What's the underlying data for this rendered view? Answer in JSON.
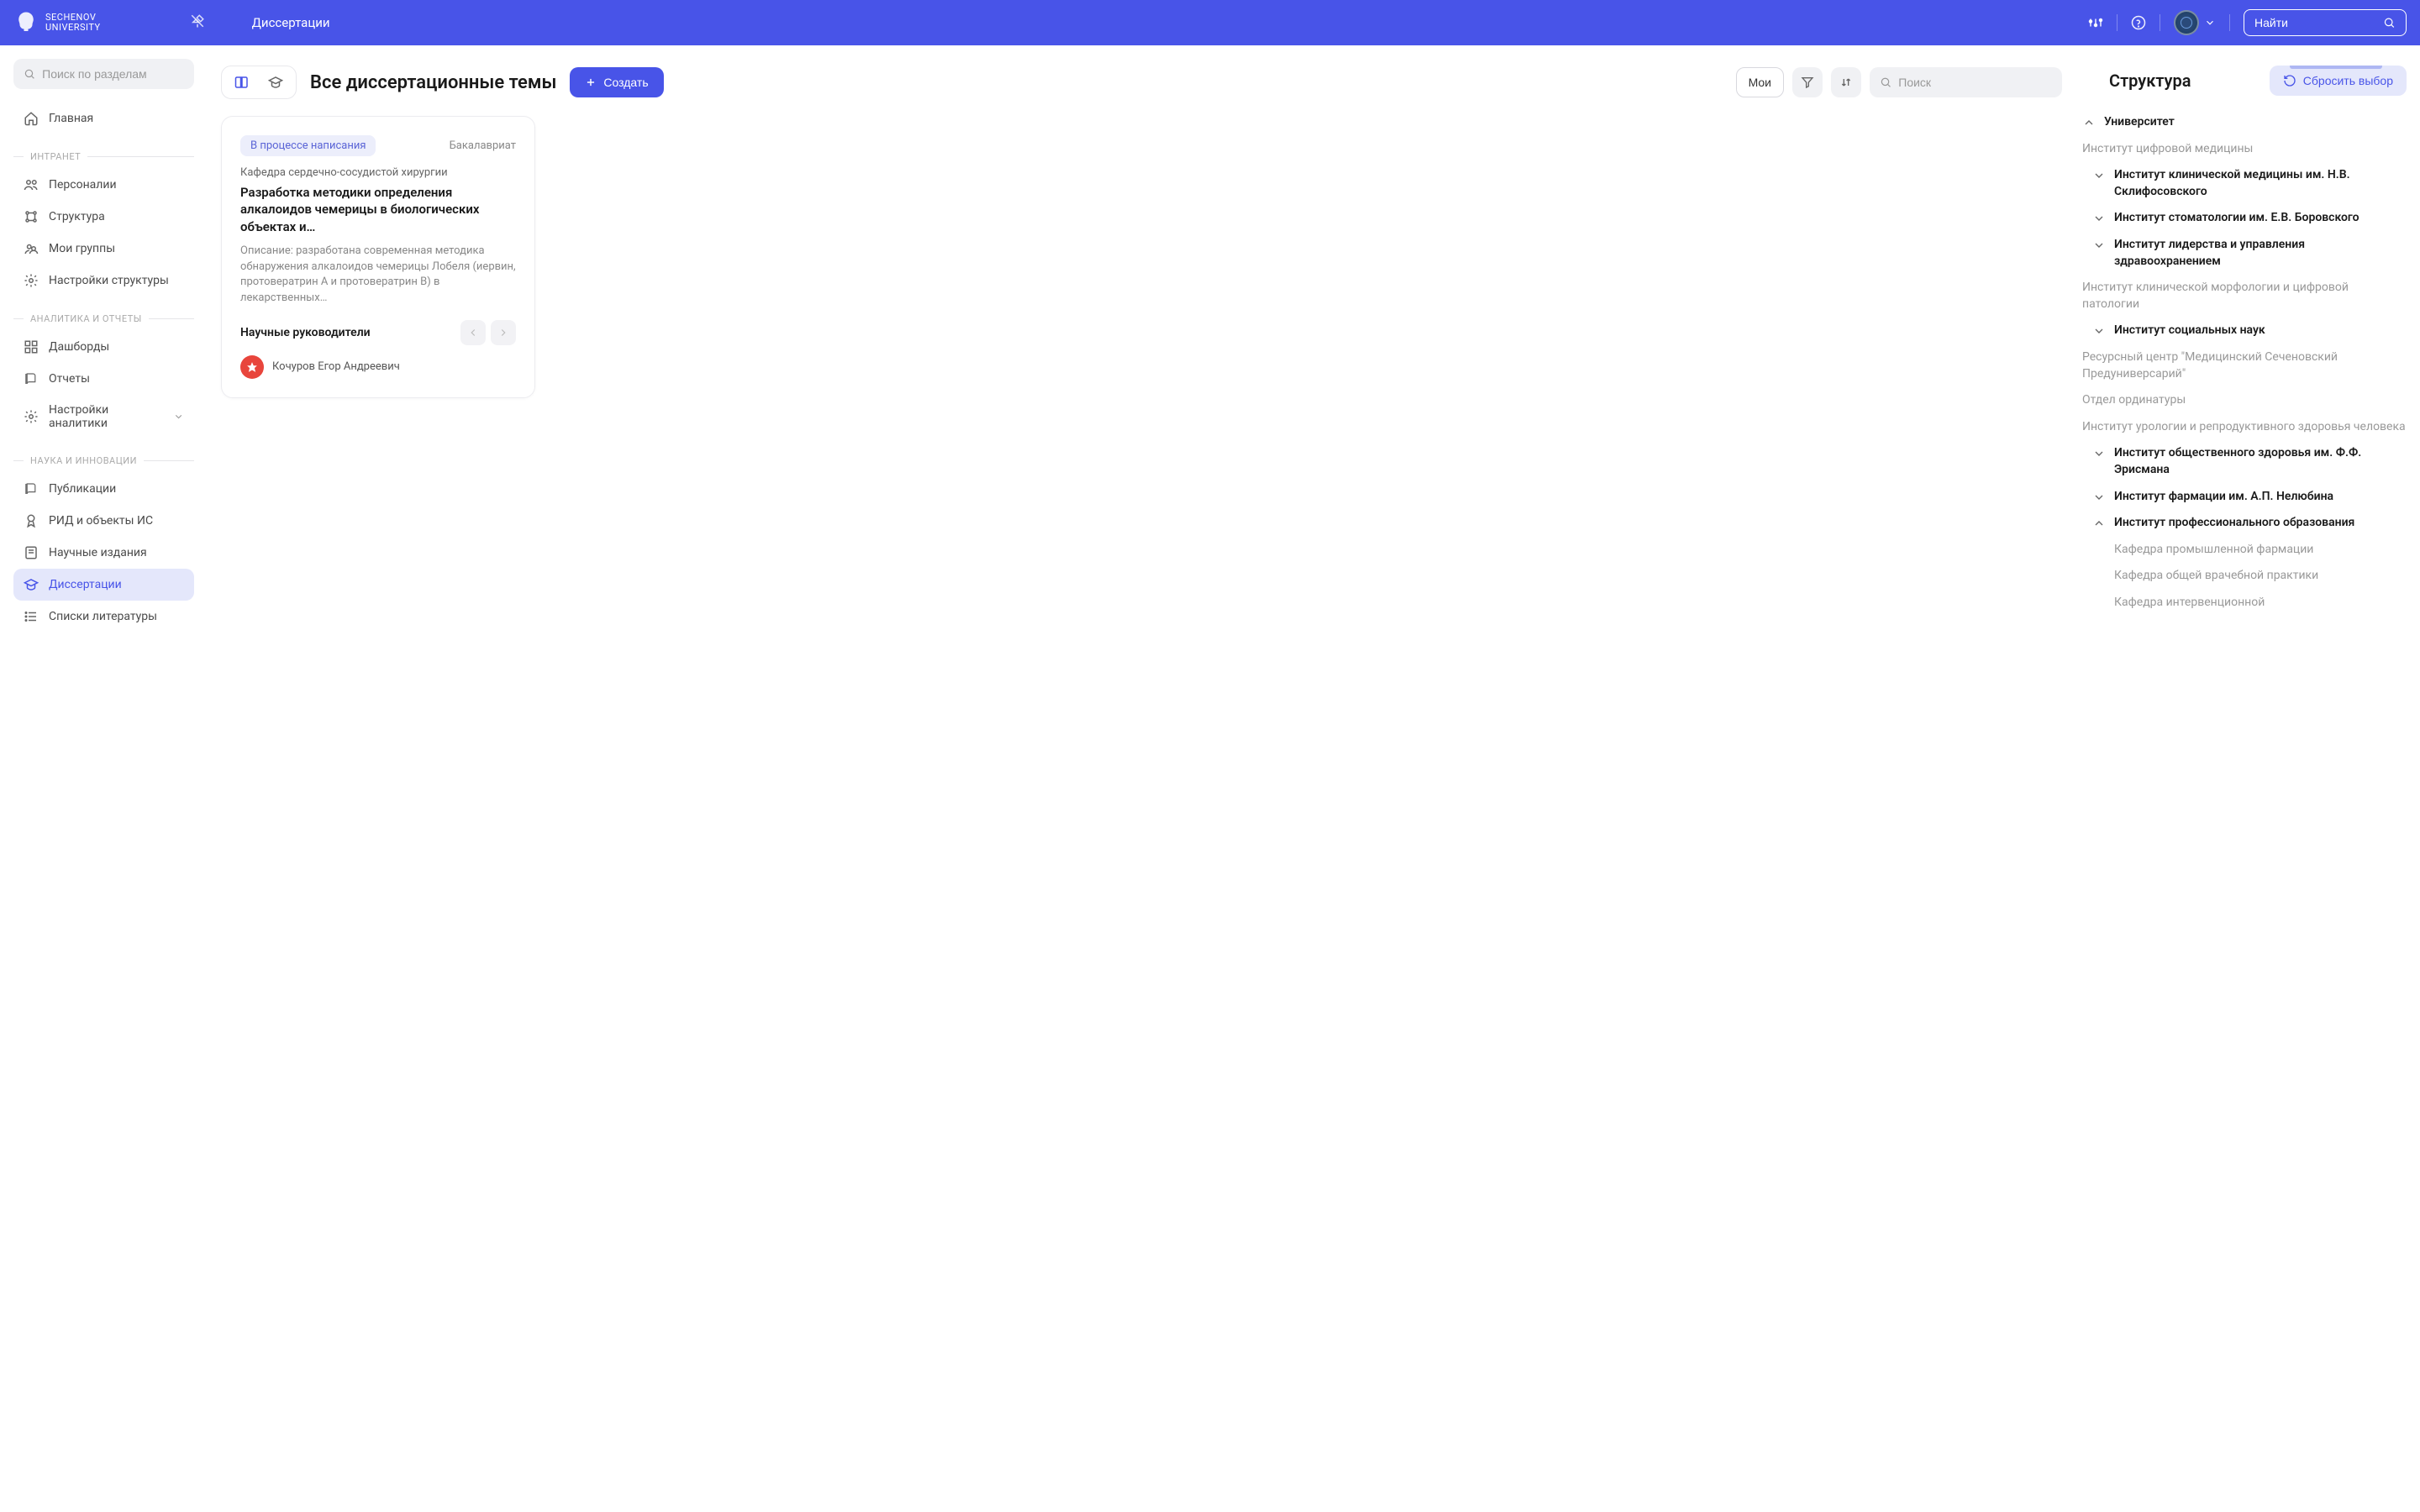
{
  "header": {
    "brand_line1": "SECHENOV",
    "brand_line2": "UNIVERSITY",
    "title": "Диссертации",
    "search_placeholder": "Найти"
  },
  "sidebar": {
    "search_placeholder": "Поиск по разделам",
    "items": [
      {
        "label": "Главная",
        "icon": "home"
      }
    ],
    "sections": [
      {
        "label": "ИНТРАНЕТ",
        "items": [
          {
            "label": "Персоналии",
            "icon": "users"
          },
          {
            "label": "Структура",
            "icon": "structure"
          },
          {
            "label": "Мои группы",
            "icon": "groups"
          },
          {
            "label": "Настройки структуры",
            "icon": "gear"
          }
        ]
      },
      {
        "label": "АНАЛИТИКА И ОТЧЕТЫ",
        "items": [
          {
            "label": "Дашборды",
            "icon": "dashboard"
          },
          {
            "label": "Отчеты",
            "icon": "book"
          },
          {
            "label": "Настройки аналитики",
            "icon": "gear",
            "expandable": true
          }
        ]
      },
      {
        "label": "НАУКА И ИННОВАЦИИ",
        "items": [
          {
            "label": "Публикации",
            "icon": "book"
          },
          {
            "label": "РИД и объекты ИС",
            "icon": "award"
          },
          {
            "label": "Научные издания",
            "icon": "journal"
          },
          {
            "label": "Диссертации",
            "icon": "graduation",
            "active": true
          },
          {
            "label": "Списки литературы",
            "icon": "list"
          }
        ]
      }
    ]
  },
  "content": {
    "title": "Все диссертационные темы",
    "create_label": "Создать",
    "mine_label": "Мои",
    "search_placeholder": "Поиск"
  },
  "card": {
    "status": "В процессе написания",
    "degree": "Бакалавриат",
    "department": "Кафедра сердечно-сосудистой хирургии",
    "title": "Разработка методики определения алкалоидов чемерицы в биологических объектах и…",
    "description": "Описание: разработана современная методика обнаружения алкалоидов чемерицы Лобеля (иервин, протовератрин А и протовератрин В) в лекарственных…",
    "supervisors_label": "Научные руководители",
    "supervisor_name": "Кочуров Егор Андреевич"
  },
  "structure": {
    "title": "Структура",
    "reset_label": "Сбросить выбор",
    "root": "Университет",
    "tree": [
      {
        "label": "Институт цифровой медицины",
        "muted": true,
        "leaf": true
      },
      {
        "label": "Институт клинической медицины им. Н.В. Склифосовского",
        "bold": true,
        "chevron": "down"
      },
      {
        "label": "Институт стоматологии им. Е.В. Боровского",
        "bold": true,
        "chevron": "down"
      },
      {
        "label": "Институт лидерства и управления здравоохранением",
        "bold": true,
        "chevron": "down"
      },
      {
        "label": "Институт клинической морфологии и цифровой патологии",
        "muted": true,
        "leaf": true
      },
      {
        "label": "Институт социальных наук",
        "bold": true,
        "chevron": "down"
      },
      {
        "label": "Ресурсный центр \"Медицинский Сеченовский Предуниверсарий\"",
        "muted": true,
        "leaf": true
      },
      {
        "label": "Отдел ординатуры",
        "muted": true,
        "leaf": true
      },
      {
        "label": "Институт урологии и репродуктивного здоровья человека",
        "muted": true,
        "leaf": true
      },
      {
        "label": "Институт общественного здоровья им. Ф.Ф. Эрисмана",
        "bold": true,
        "chevron": "down"
      },
      {
        "label": "Институт фармации им. А.П. Нелюбина",
        "bold": true,
        "chevron": "down"
      },
      {
        "label": "Институт профессионального образования",
        "bold": true,
        "chevron": "up",
        "expanded": true,
        "children": [
          {
            "label": "Кафедра промышленной фармации",
            "muted": true
          },
          {
            "label": "Кафедра общей врачебной практики",
            "muted": true
          },
          {
            "label": "Кафедра интервенционной",
            "muted": true
          }
        ]
      }
    ]
  }
}
